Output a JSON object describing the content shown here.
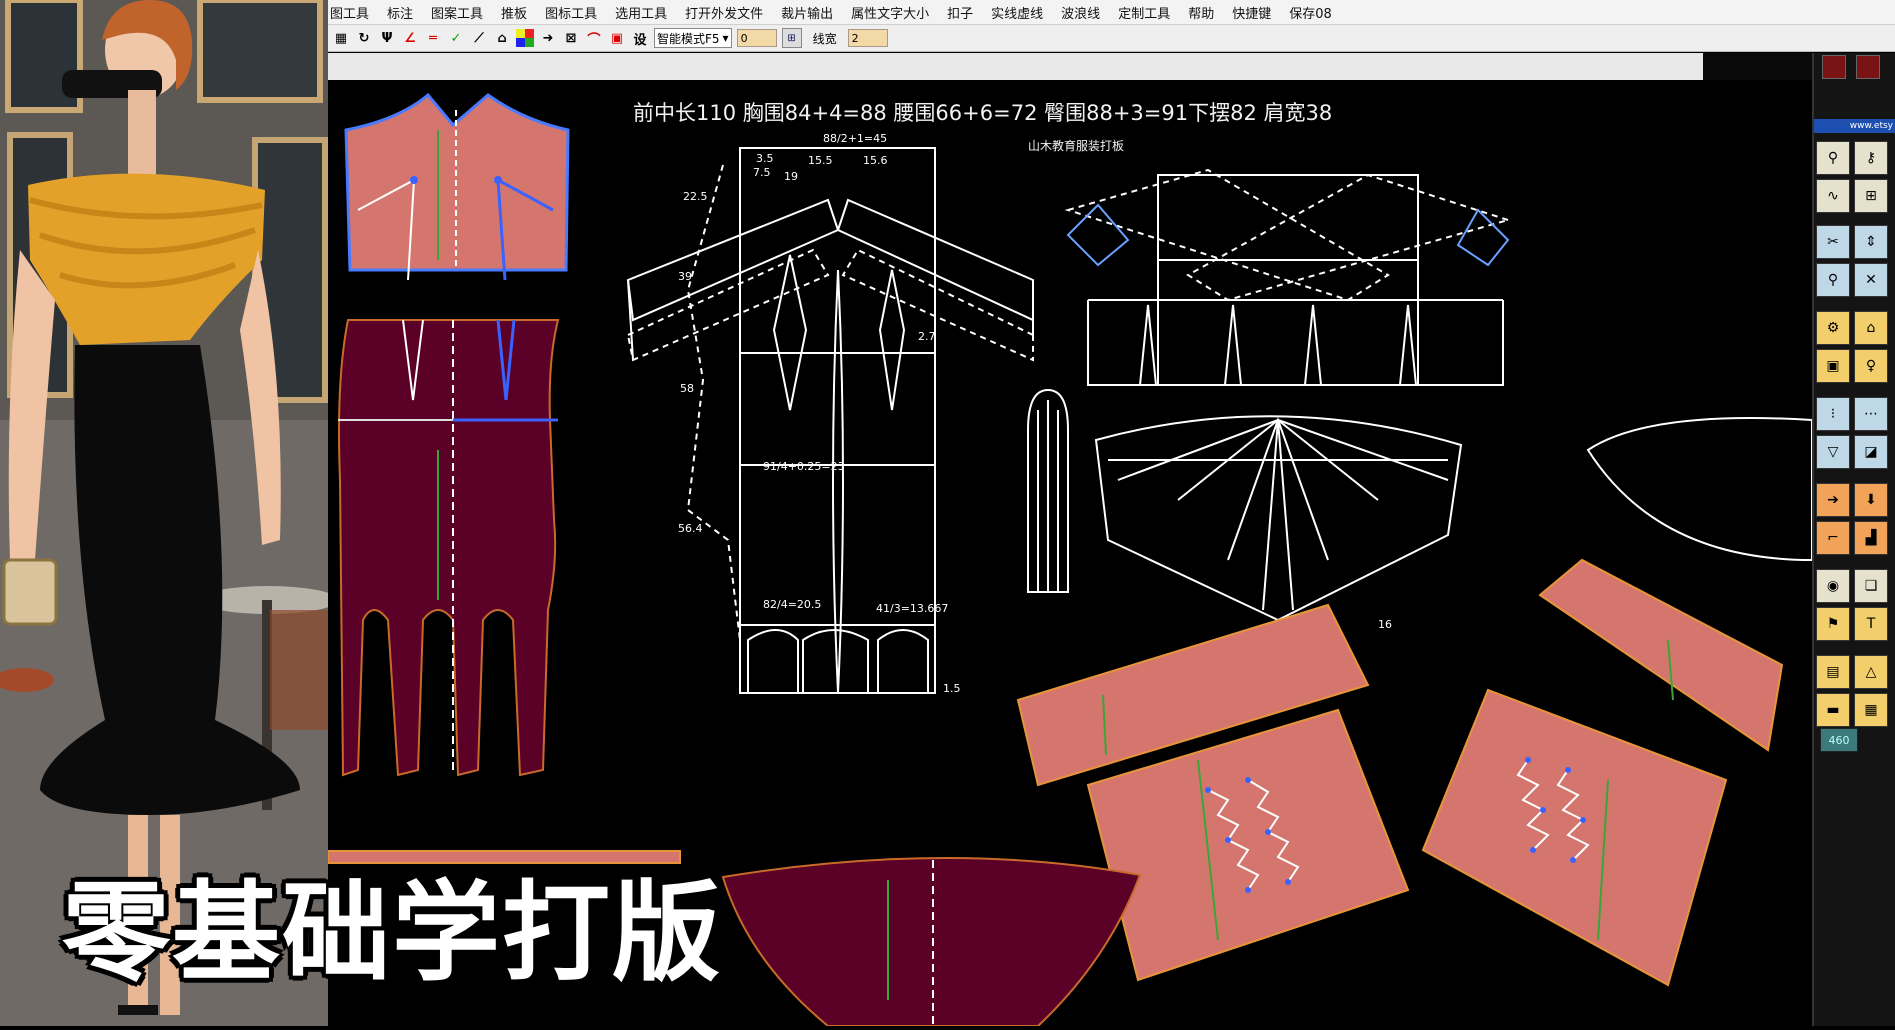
{
  "menu": {
    "items": [
      "图工具",
      "标注",
      "图案工具",
      "推板",
      "图标工具",
      "选用工具",
      "打开外发文件",
      "裁片输出",
      "属性文字大小",
      "扣子",
      "实线虚线",
      "波浪线",
      "定制工具",
      "帮助",
      "快捷键",
      "保存08"
    ]
  },
  "toolbar": {
    "set_label": "设",
    "mode_value": "智能模式F5",
    "input_value": "0",
    "line_width_label": "线宽",
    "line_width_value": "2"
  },
  "canvas": {
    "measurements_line": "前中长110   胸围84+4=88   腰围66+6=72   臀围88+3=91下摆82   肩宽38",
    "studio_label": "山木教育服装打板",
    "dim_labels": {
      "a": "22.5",
      "b": "39",
      "c": "58",
      "d": "56.4",
      "e": "15.5",
      "f": "15.6",
      "g": "88/2+1=45",
      "h": "91/4+0.25=23",
      "i": "82/4=20.5",
      "j": "41/3=13.667",
      "k": "2.7",
      "l": "1.5",
      "m": "16",
      "n": "3.5",
      "o": "7.5",
      "p": "19"
    }
  },
  "sidebar": {
    "banner": "www.etsy",
    "counter": "460"
  },
  "overlay": {
    "caption": "零基础学打版"
  },
  "colors": {
    "pink_piece": "#d6786e",
    "maroon_piece": "#5a0028",
    "canvas_bg": "#000000",
    "accent_blue": "#1d4fb0"
  }
}
